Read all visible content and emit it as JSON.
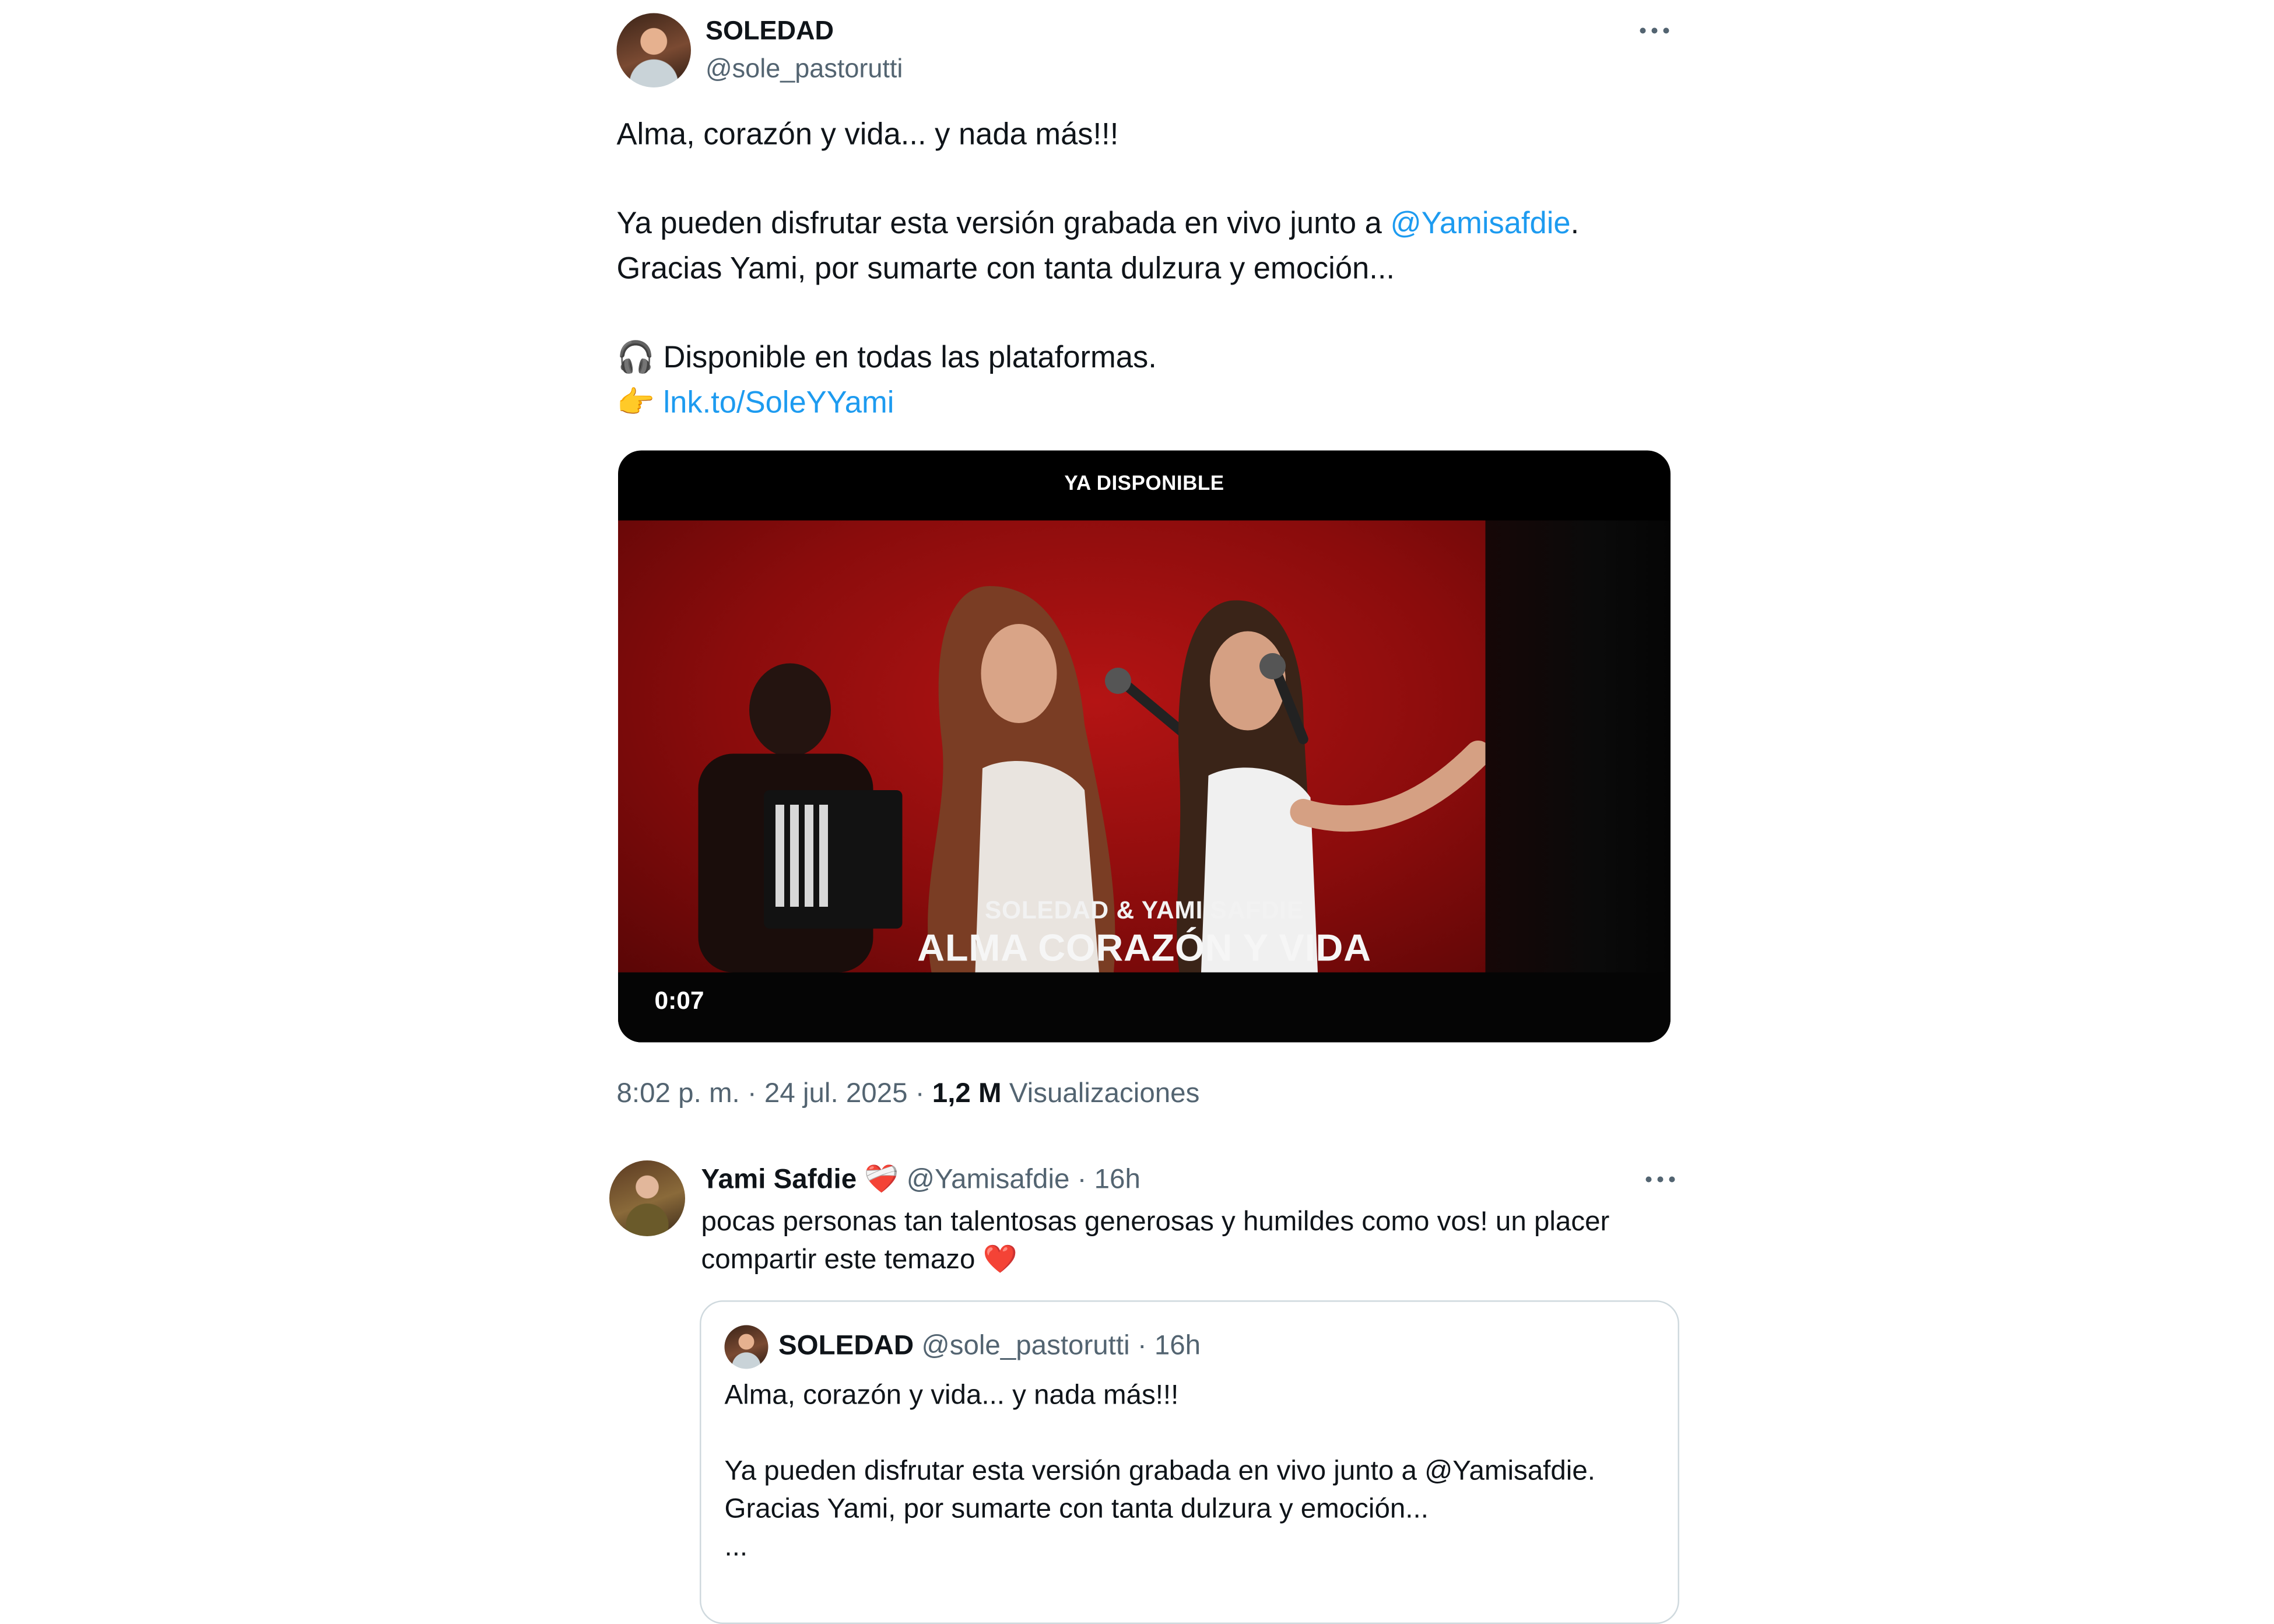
{
  "main_tweet": {
    "display_name": "SOLEDAD",
    "handle": "@sole_pastorutti",
    "more_icon": "more-horizontal-icon",
    "line1": "Alma, corazón y vida... y nada más!!!",
    "line2_prefix": "Ya pueden disfrutar esta versión grabada en vivo junto a ",
    "line2_mention": "@Yamisafdie",
    "line2_suffix": ".",
    "line3": "Gracias Yami, por sumarte con tanta dulzura y emoción...",
    "line4_emoji": "🎧",
    "line4_text": " Disponible en todas las plataformas.",
    "line5_emoji": "👉",
    "link_text": "lnk.to/SoleYYami",
    "video": {
      "top_label": "YA DISPONIBLE",
      "subtitle": "SOLEDAD & YAMI SAFDIE",
      "title": "ALMA CORAZÓN Y VIDA",
      "timestamp": "0:07"
    },
    "posted_at": "8:02 p. m. · 24 jul. 2025 · ",
    "views_count": "1,2 M",
    "views_label": " Visualizaciones"
  },
  "reply": {
    "display_name": "Yami Safdie",
    "badge_emoji": "❤️‍🩹",
    "handle_time": "@Yamisafdie · 16h",
    "text_line1": "pocas personas tan talentosas generosas y humildes como vos! un placer",
    "text_line2": "compartir este temazo ",
    "heart_emoji": "❤️",
    "quoted": {
      "display_name": "SOLEDAD",
      "handle_time": "@sole_pastorutti · 16h",
      "line1": "Alma, corazón y vida... y nada más!!!",
      "line2": "Ya pueden disfrutar esta versión grabada en vivo junto a @Yamisafdie.",
      "line3": "Gracias Yami, por sumarte con tanta dulzura y emoción...",
      "line4": "..."
    }
  }
}
